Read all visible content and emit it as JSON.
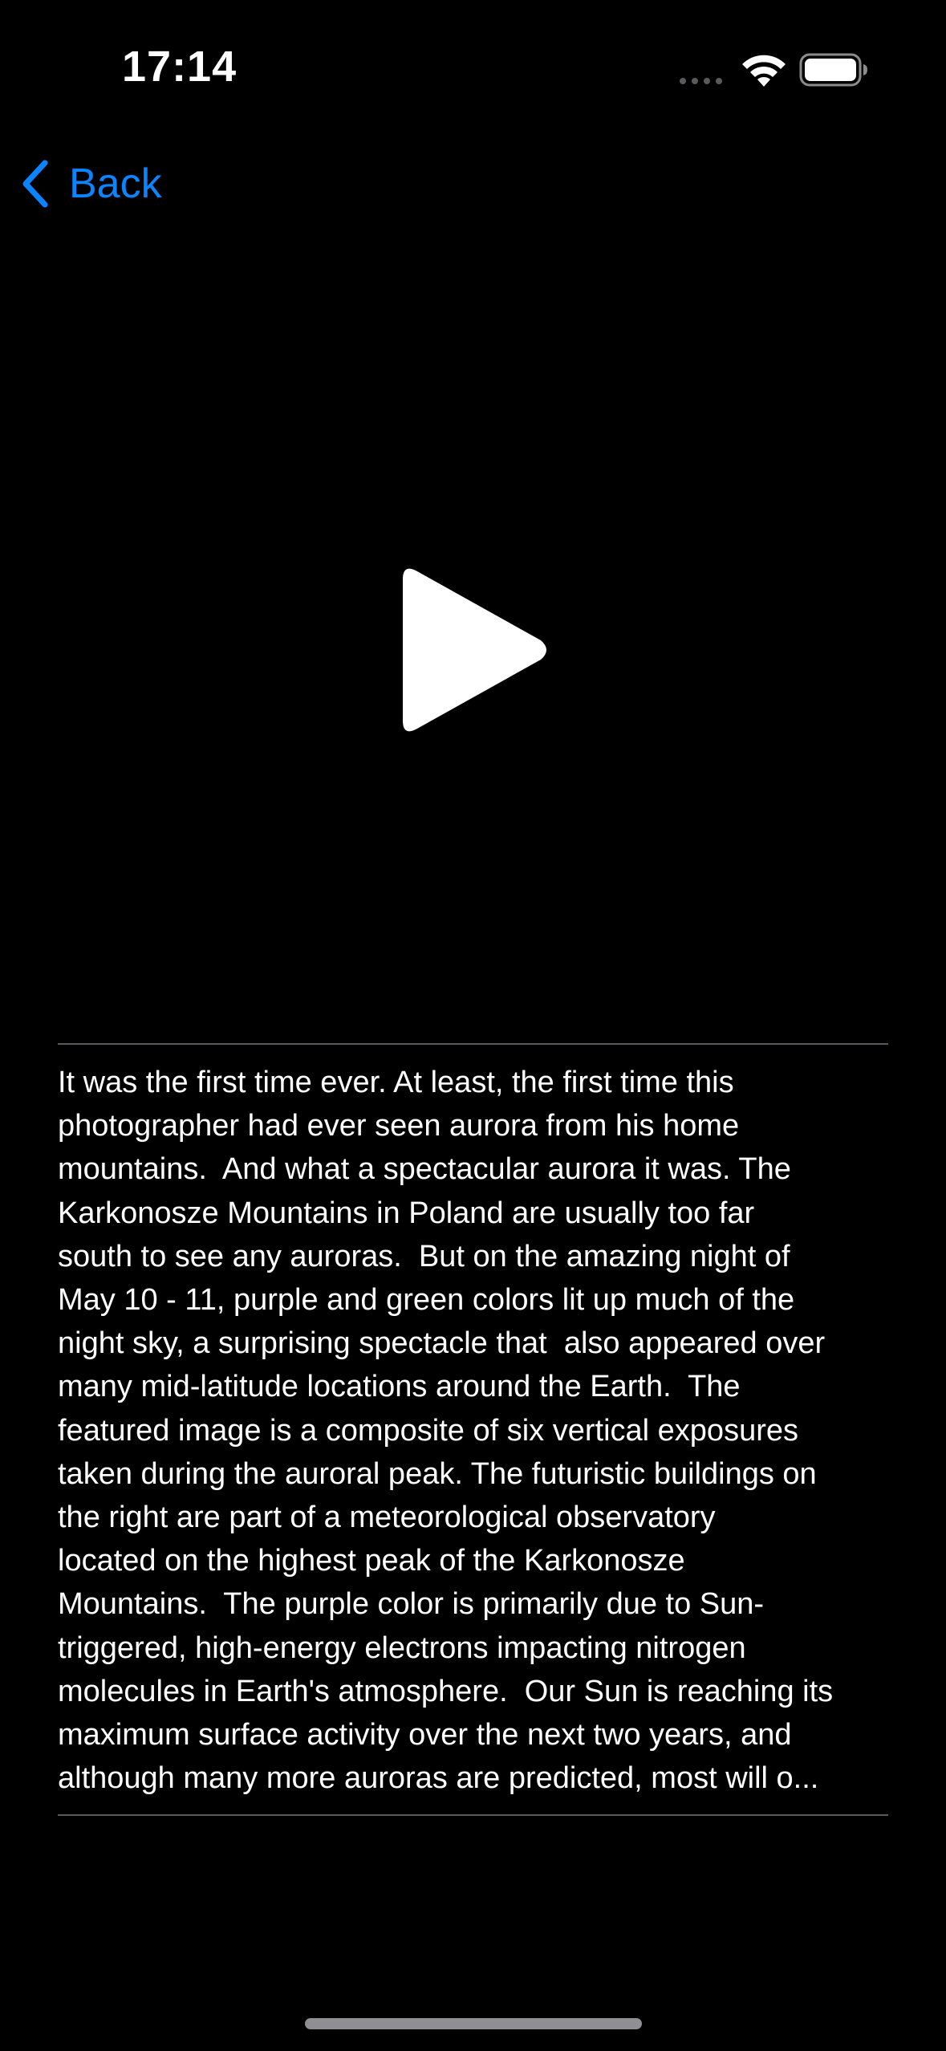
{
  "status_bar": {
    "time": "17:14"
  },
  "navigation": {
    "back_label": "Back"
  },
  "video": {
    "play_icon": "play-icon"
  },
  "description": {
    "lines": [
      "It was the first time ever. At least, the first time this",
      "photographer had ever seen aurora from his home",
      "mountains.  And what a spectacular aurora it was. The",
      "Karkonosze Mountains in Poland are usually too far",
      "south to see any auroras.  But on the amazing night of",
      "May 10 - 11, purple and green colors lit up much of the",
      "night sky, a surprising spectacle that  also appeared over",
      "many mid-latitude locations around the Earth.  The",
      "featured image is a composite of six vertical exposures",
      "taken during the auroral peak. The futuristic buildings on",
      "the right are part of a meteorological observatory",
      "located on the highest peak of the Karkonosze",
      "Mountains.  The purple color is primarily due to Sun-",
      "triggered, high-energy electrons impacting nitrogen",
      "molecules in Earth's atmosphere.  Our Sun is reaching its",
      "maximum surface activity over the next two years, and",
      "although many more auroras are predicted, most will o..."
    ]
  },
  "colors": {
    "accent": "#0a84ff",
    "background": "#000000",
    "text": "#ffffff"
  }
}
